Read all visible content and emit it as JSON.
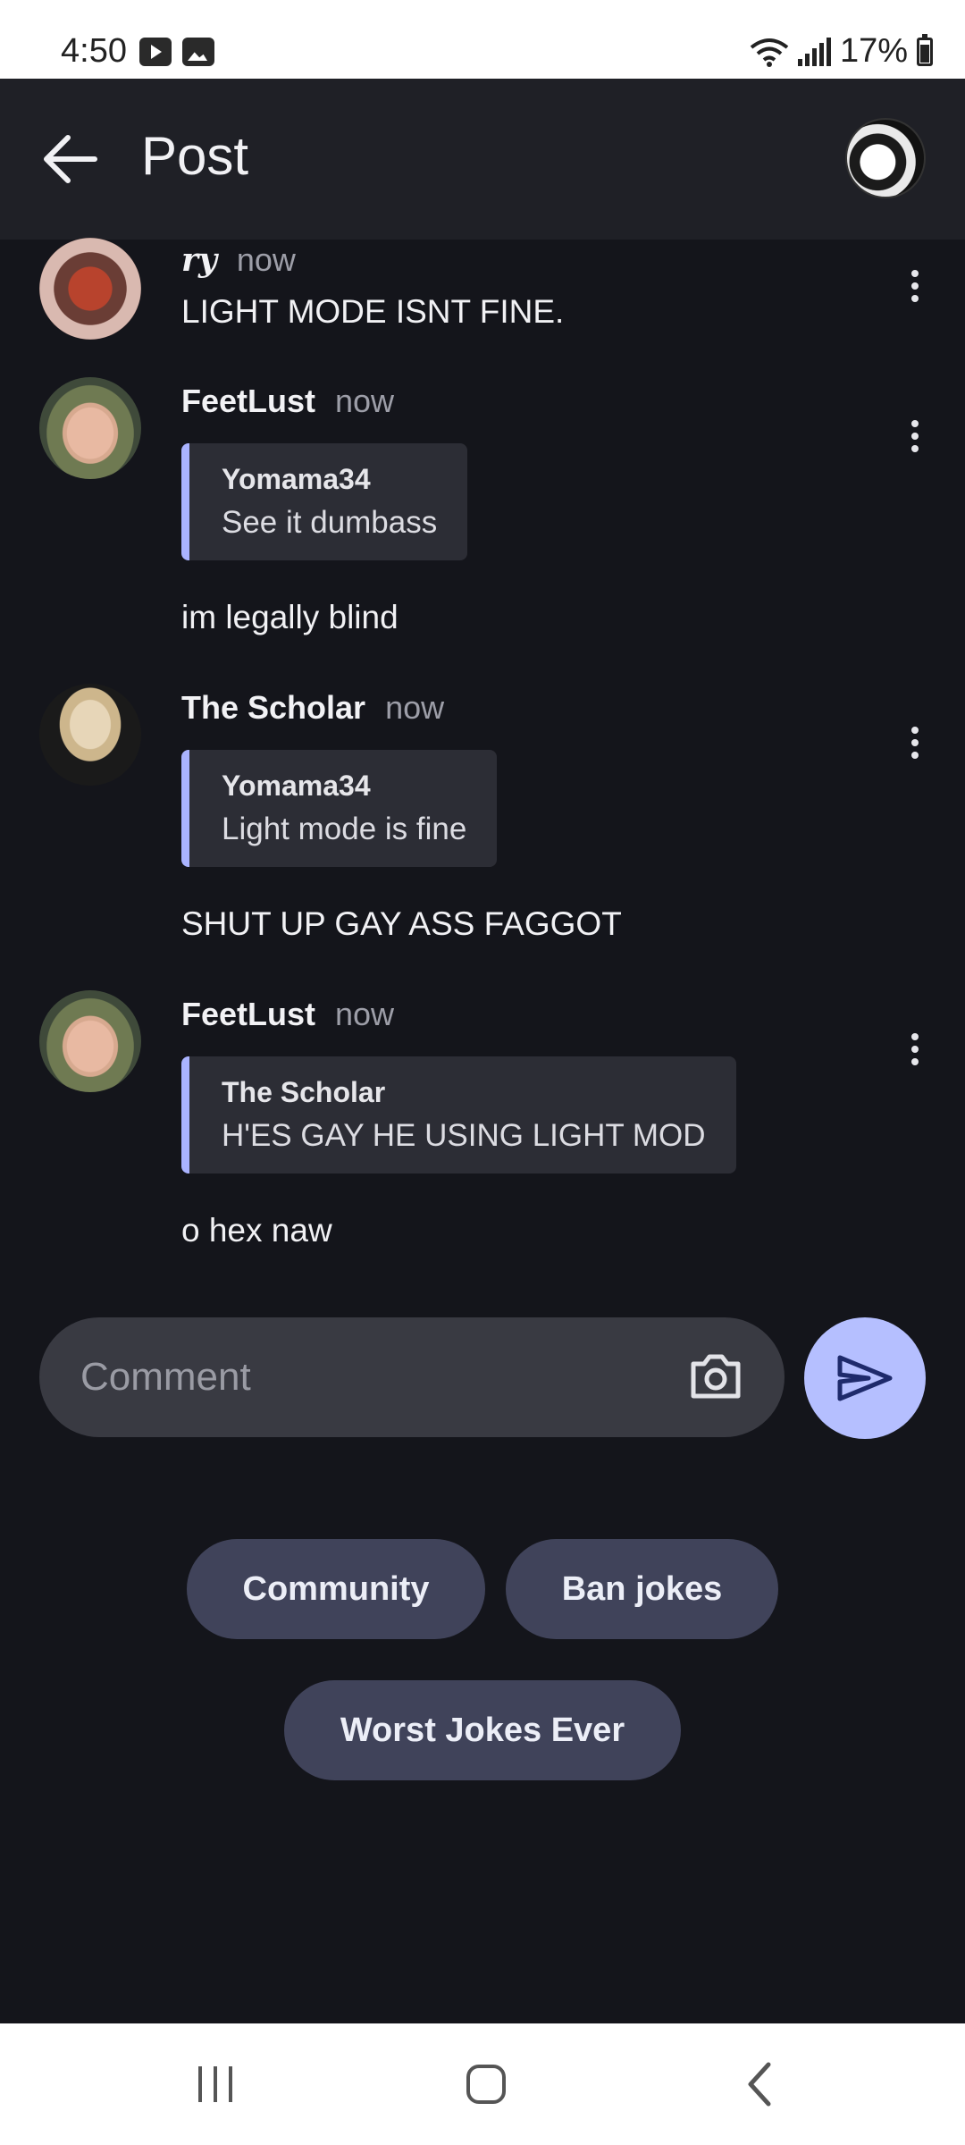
{
  "status_bar": {
    "time": "4:50",
    "battery": "17%"
  },
  "app_bar": {
    "title": "Post"
  },
  "comments": [
    {
      "author": "ry",
      "time": "now",
      "text": "LIGHT MODE ISNT FINE."
    },
    {
      "author": "FeetLust",
      "time": "now",
      "quote": {
        "author": "Yomama34",
        "text": "See it dumbass"
      },
      "text": "im legally blind"
    },
    {
      "author": "The Scholar",
      "time": "now",
      "quote": {
        "author": "Yomama34",
        "text": "Light mode is fine"
      },
      "text": "SHUT UP GAY ASS FAGGOT"
    },
    {
      "author": "FeetLust",
      "time": "now",
      "quote": {
        "author": "The Scholar",
        "text": "H'ES GAY HE USING LIGHT MOD"
      },
      "text": "o hex naw"
    }
  ],
  "comment_input": {
    "placeholder": "Comment"
  },
  "chips": {
    "community": "Community",
    "ban_jokes": "Ban jokes",
    "worst_jokes": "Worst Jokes Ever"
  },
  "colors": {
    "background": "#14151b",
    "accent": "#b5bfff",
    "chip": "#40435a",
    "quote_bar": "#aab3ff"
  }
}
